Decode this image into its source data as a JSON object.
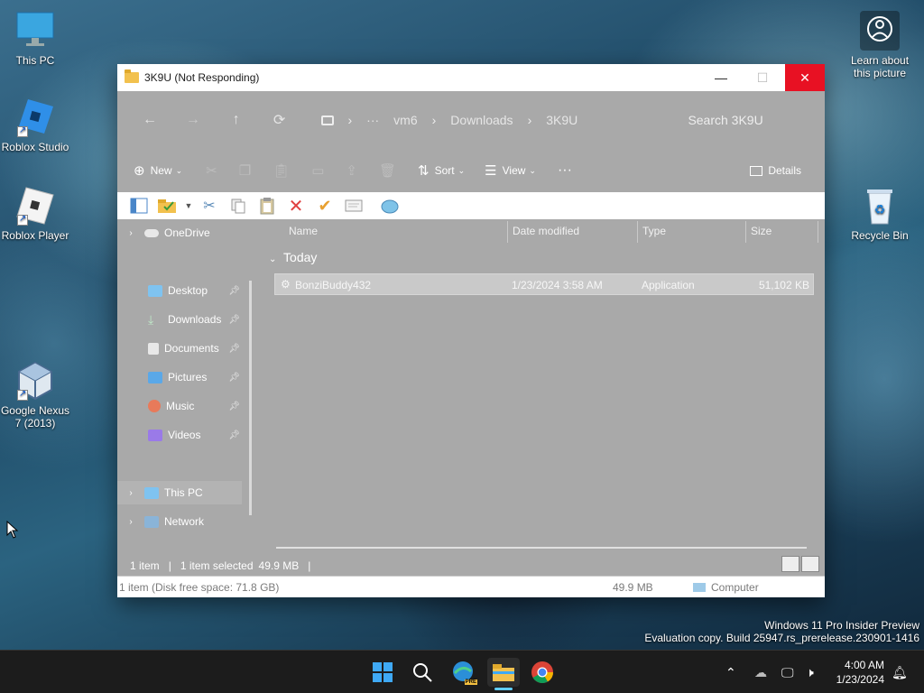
{
  "desktop": {
    "icons": [
      {
        "label": "This PC"
      },
      {
        "label": "Roblox Studio"
      },
      {
        "label": "Roblox Player"
      },
      {
        "label": "Google Nexus 7 (2013)"
      },
      {
        "label": "Recycle Bin"
      },
      {
        "label": "Learn about this picture"
      }
    ]
  },
  "window": {
    "title": "3K9U (Not Responding)",
    "controls": {
      "minimize": "—",
      "maximize": "☐",
      "close": "✕"
    }
  },
  "navigation": {
    "back": "←",
    "forward": "→",
    "up": "↑",
    "refresh": "⟳",
    "breadcrumb": [
      "vm6",
      "Downloads",
      "3K9U"
    ],
    "overflow": "···",
    "search_placeholder": "Search 3K9U"
  },
  "commandbar": {
    "new_label": "New",
    "sort_label": "Sort",
    "view_label": "View",
    "more_label": "···",
    "details_label": "Details"
  },
  "navpane": {
    "onedrive": "OneDrive",
    "quick": [
      {
        "label": "Desktop",
        "color": "#7fc3f0"
      },
      {
        "label": "Downloads",
        "color": "#58b06b"
      },
      {
        "label": "Documents",
        "color": "#e8e8e8"
      },
      {
        "label": "Pictures",
        "color": "#5aa8e8"
      },
      {
        "label": "Music",
        "color": "#e87a5a"
      },
      {
        "label": "Videos",
        "color": "#9a7ae8"
      }
    ],
    "thispc": "This PC",
    "network": "Network"
  },
  "columns": {
    "name": "Name",
    "date": "Date modified",
    "type": "Type",
    "size": "Size"
  },
  "group_label": "Today",
  "files": [
    {
      "name": "BonziBuddy432",
      "date": "1/23/2024 3:58 AM",
      "type": "Application",
      "size": "51,102 KB"
    }
  ],
  "status": {
    "count": "1 item",
    "selected": "1 item selected",
    "selected_size": "49.9 MB",
    "sep": "|"
  },
  "bottombar": {
    "left": "1 item (Disk free space: 71.8 GB)",
    "size": "49.9 MB",
    "location": "Computer"
  },
  "watermark": {
    "line1": "Windows 11 Pro Insider Preview",
    "line2": "Evaluation copy. Build 25947.rs_prerelease.230901-1416"
  },
  "clock": {
    "time": "4:00 AM",
    "date": "1/23/2024"
  },
  "taskbar": {
    "edge_badge": "PRE"
  }
}
